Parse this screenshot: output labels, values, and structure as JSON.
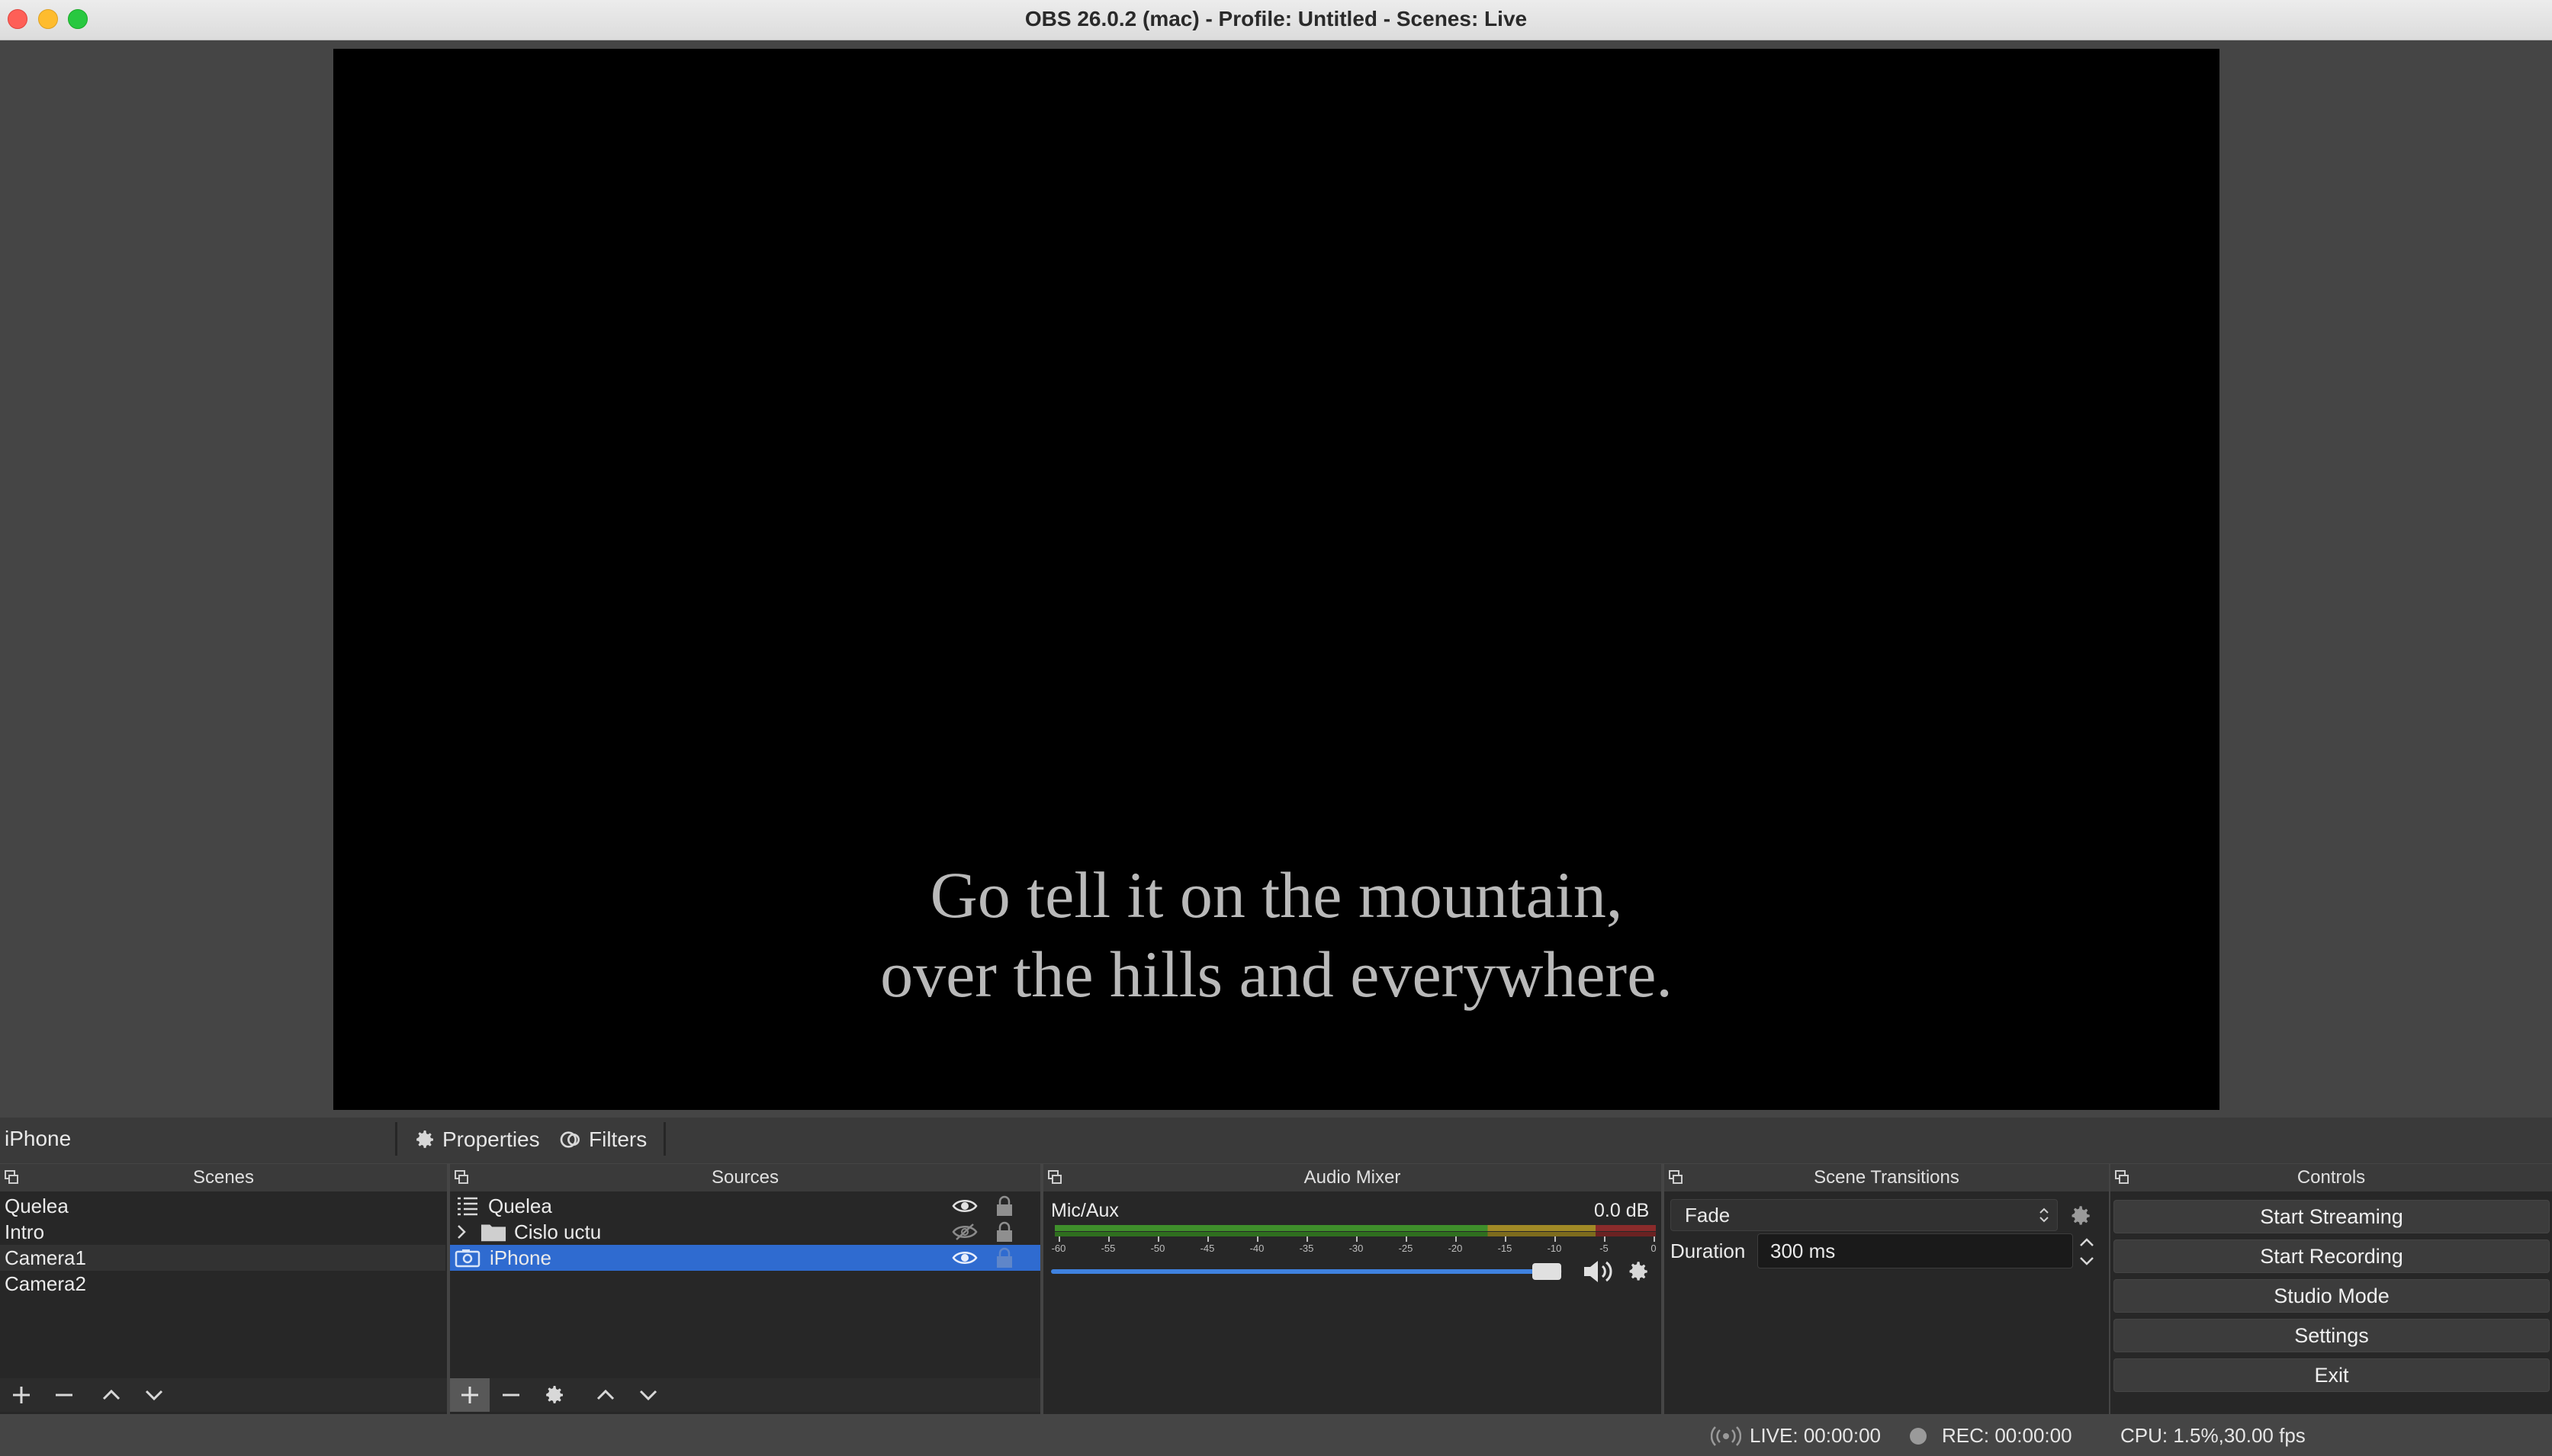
{
  "window": {
    "title": "OBS 26.0.2 (mac) - Profile: Untitled - Scenes: Live"
  },
  "preview": {
    "line1": "Go tell it on the mountain,",
    "line2": "over the hills and everywhere."
  },
  "source_toolbar": {
    "selected_source": "iPhone",
    "properties_label": "Properties",
    "filters_label": "Filters"
  },
  "scenes": {
    "title": "Scenes",
    "items": [
      {
        "label": "Quelea"
      },
      {
        "label": "Intro"
      },
      {
        "label": "Camera1"
      },
      {
        "label": "Camera2"
      }
    ],
    "active_index": 2
  },
  "sources": {
    "title": "Sources",
    "items": [
      {
        "label": "Quelea",
        "icon": "list-icon",
        "visible": true,
        "locked": true
      },
      {
        "label": "Cislo uctu",
        "icon": "folder-icon",
        "visible": false,
        "locked": true,
        "group": true
      },
      {
        "label": "iPhone",
        "icon": "camera-icon",
        "visible": true,
        "locked": true,
        "selected": true
      }
    ]
  },
  "audio_mixer": {
    "title": "Audio Mixer",
    "channel_name": "Mic/Aux",
    "level_db": "0.0 dB",
    "tick_labels": [
      "-60",
      "-55",
      "-50",
      "-45",
      "-40",
      "-35",
      "-30",
      "-25",
      "-20",
      "-15",
      "-10",
      "-5",
      "0"
    ],
    "volume_fraction": 0.97
  },
  "scene_transitions": {
    "title": "Scene Transitions",
    "transition": "Fade",
    "duration_label": "Duration",
    "duration_value": "300 ms"
  },
  "controls": {
    "title": "Controls",
    "start_streaming": "Start Streaming",
    "start_recording": "Start Recording",
    "studio_mode": "Studio Mode",
    "settings": "Settings",
    "exit": "Exit"
  },
  "status_bar": {
    "live": "LIVE: 00:00:00",
    "rec": "REC: 00:00:00",
    "cpu": "CPU: 1.5%,30.00 fps"
  },
  "colors": {
    "selection": "#2f6bd0",
    "background": "#454545",
    "panel": "#272727"
  }
}
